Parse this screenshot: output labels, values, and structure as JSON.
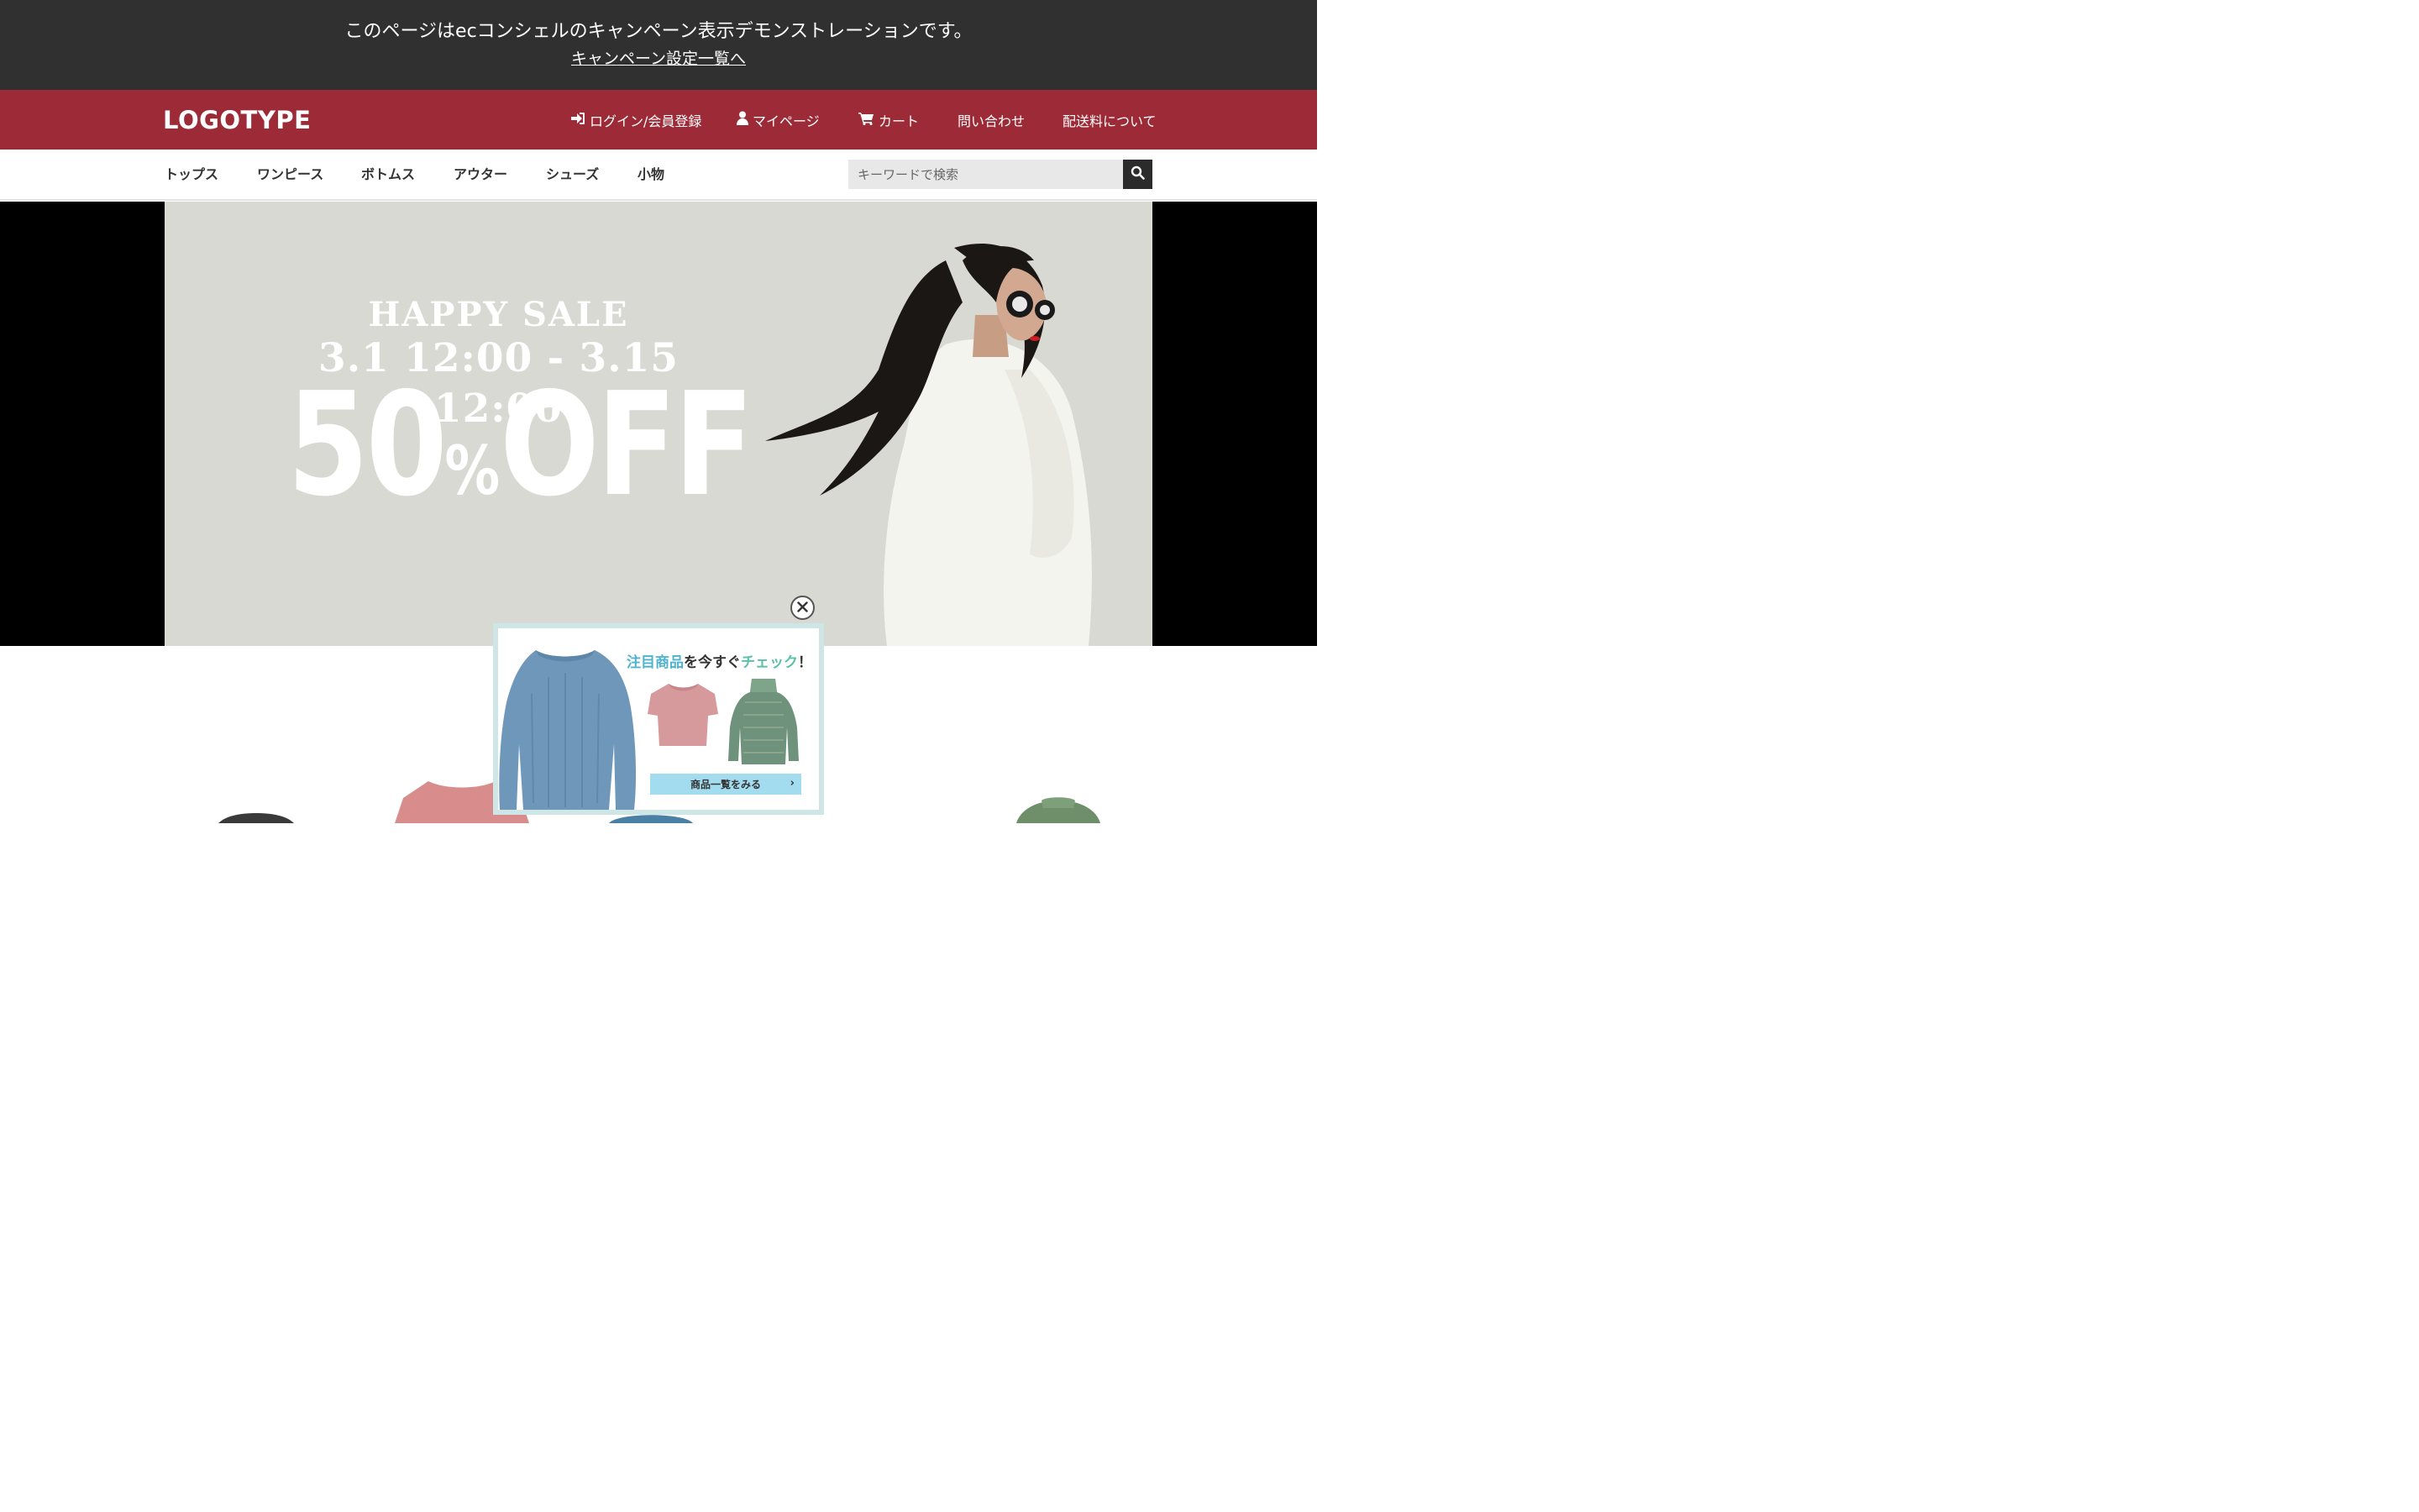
{
  "demo": {
    "message": "このページはecコンシェルのキャンペーン表示デモンストレーションです。",
    "link": "キャンペーン設定一覧へ"
  },
  "header": {
    "logo": "LOGOTYPE",
    "nav": [
      {
        "label": "ログイン/会員登録",
        "icon": "sign-in-icon"
      },
      {
        "label": "マイページ",
        "icon": "user-icon"
      },
      {
        "label": "カート",
        "icon": "cart-icon"
      },
      {
        "label": "問い合わせ"
      },
      {
        "label": "配送料について"
      }
    ]
  },
  "categories": [
    "トップス",
    "ワンピース",
    "ボトムス",
    "アウター",
    "シューズ",
    "小物"
  ],
  "search": {
    "placeholder": "キーワードで検索",
    "button_icon": "search-icon"
  },
  "hero": {
    "line1": "HAPPY SALE",
    "line2": "3.1  12:00 - 3.15  12:00",
    "discount_number": "50",
    "discount_percent": "%",
    "discount_word": "OFF"
  },
  "popup": {
    "title_part1": "注目商品",
    "title_part2": "を今すぐ",
    "title_part3": "チェック",
    "title_part4": "！",
    "button": "商品一覧をみる",
    "close_icon": "close-icon"
  },
  "colors": {
    "demo_bar": "#303030",
    "header": "#9c2b37",
    "hero_bg": "#d8d9d3",
    "popup_accent": "#4fb3cf",
    "popup_button": "#a4dcef"
  }
}
